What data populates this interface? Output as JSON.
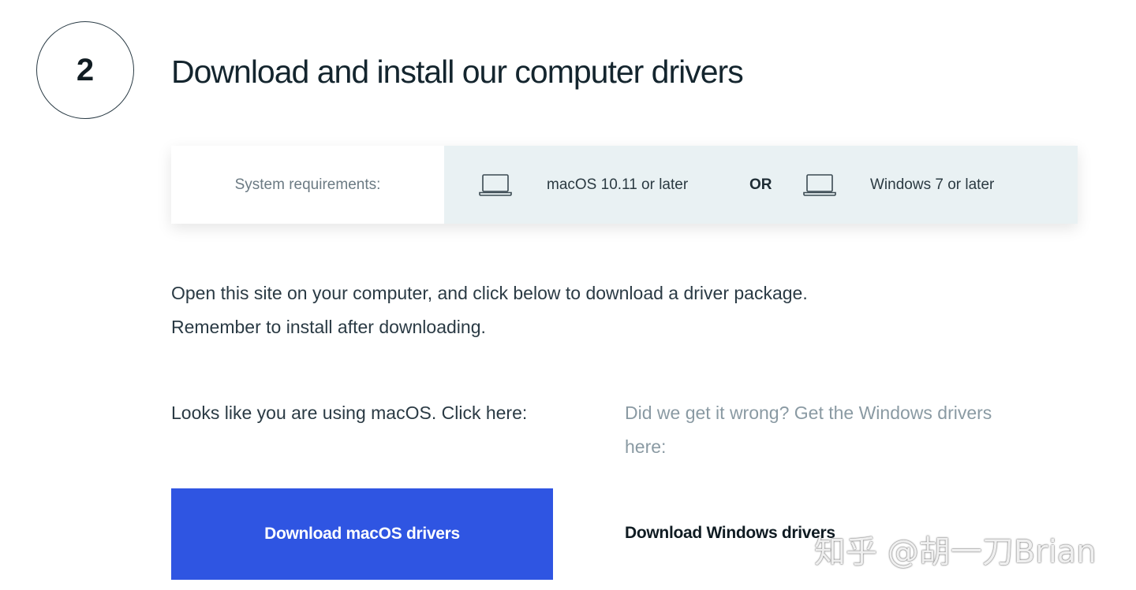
{
  "step": {
    "number": "2",
    "title": "Download and install our computer drivers"
  },
  "requirements": {
    "label": "System requirements:",
    "mac": {
      "icon": "laptop-icon",
      "text": "macOS 10.11 or later"
    },
    "separator": "OR",
    "windows": {
      "icon": "laptop-icon",
      "text": "Windows 7 or later"
    }
  },
  "intro": {
    "line1": "Open this site on your computer, and click below to download a driver package.",
    "line2": "Remember to install after downloading."
  },
  "mac_section": {
    "text": "Looks like you are using macOS. Click here:",
    "button_label": "Download macOS drivers"
  },
  "windows_section": {
    "text": "Did we get it wrong? Get the Windows drivers here:",
    "link_label": "Download Windows drivers"
  },
  "watermark": "知乎 @胡一刀Brian",
  "colors": {
    "accent": "#2f55e2",
    "panel": "#e9f1f3",
    "text": "#2a3a44",
    "muted": "#8a9aa3"
  }
}
